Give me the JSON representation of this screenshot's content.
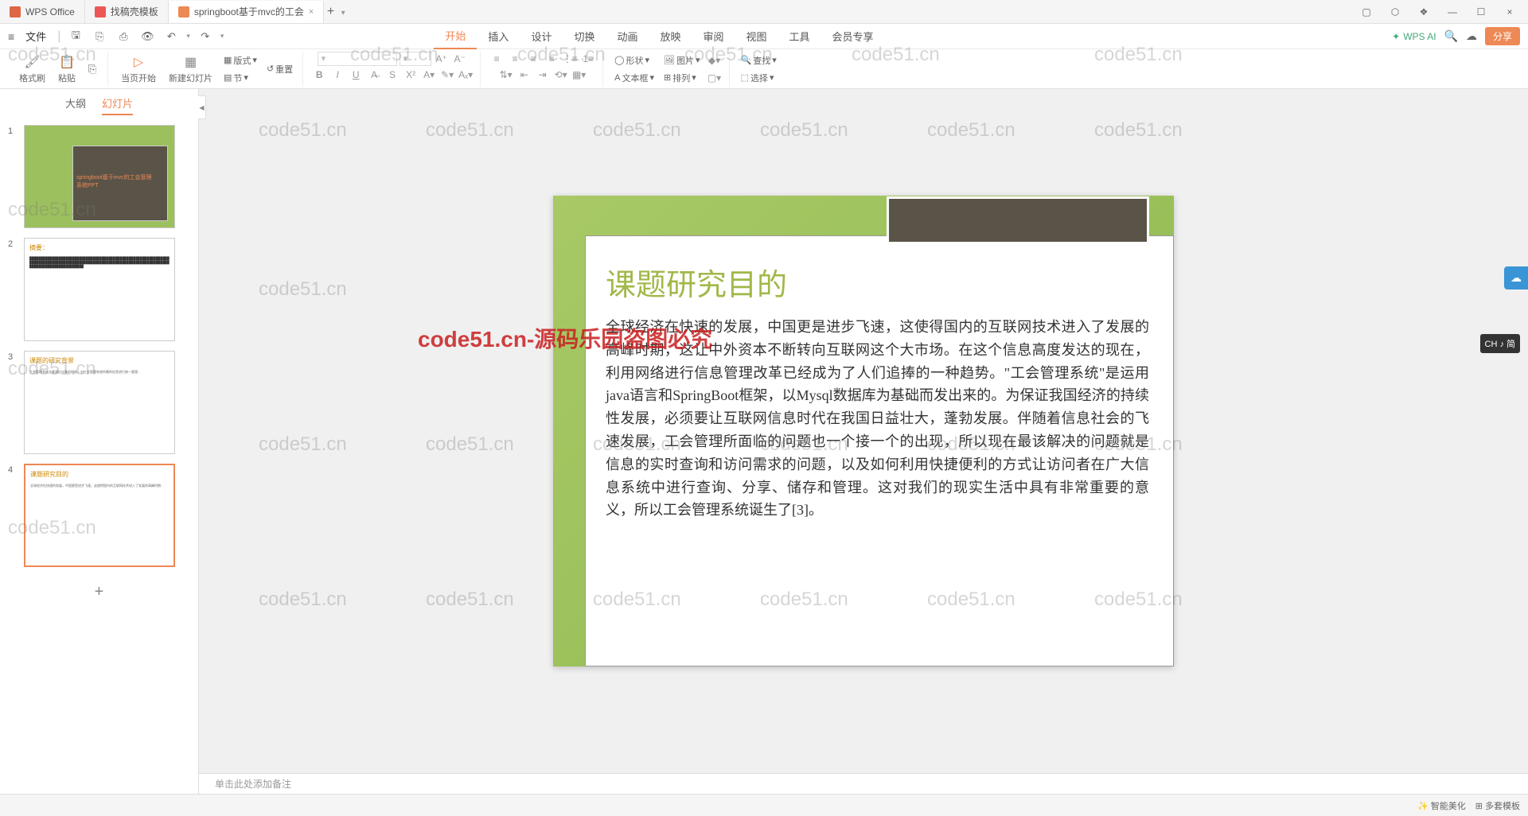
{
  "tabs": {
    "wps": "WPS Office",
    "docer": "找稿壳模板",
    "file": "springboot基于mvc的工会",
    "add": "+"
  },
  "menubar": {
    "file": "文件",
    "tabs": [
      "开始",
      "插入",
      "设计",
      "切换",
      "动画",
      "放映",
      "审阅",
      "视图",
      "工具",
      "会员专享"
    ],
    "wpsai": "WPS AI",
    "share": "分享"
  },
  "ribbon": {
    "format_painter": "格式刷",
    "paste": "粘贴",
    "from_current": "当页开始",
    "new_slide": "新建幻灯片",
    "layout": "版式",
    "section": "节",
    "reset": "重置",
    "shape": "形状",
    "picture": "图片",
    "textbox": "文本框",
    "arrange": "排列",
    "find": "查找",
    "select": "选择"
  },
  "sidebar": {
    "outline": "大纲",
    "slides": "幻灯片",
    "thumbs": [
      {
        "title": "springboot基于mvc的工会管理系统PPT"
      },
      {
        "title": "摘要："
      },
      {
        "title": "课题的研究背景"
      },
      {
        "title": "课题研究目的"
      }
    ]
  },
  "slide": {
    "title": "课题研究目的",
    "body": "全球经济在快速的发展，中国更是进步飞速，这使得国内的互联网技术进入了发展的高峰时期，这让中外资本不断转向互联网这个大市场。在这个信息高度发达的现在，利用网络进行信息管理改革已经成为了人们追捧的一种趋势。\"工会管理系统\"是运用java语言和SpringBoot框架，以Mysql数据库为基础而发出来的。为保证我国经济的持续性发展，必须要让互联网信息时代在我国日益壮大，蓬勃发展。伴随着信息社会的飞速发展，工会管理所面临的问题也一个接一个的出现，所以现在最该解决的问题就是信息的实时查询和访问需求的问题，以及如何利用快捷便利的方式让访问者在广大信息系统中进行查询、分享、储存和管理。这对我们的现实生活中具有非常重要的意义，所以工会管理系统诞生了[3]。"
  },
  "notes": "单击此处添加备注",
  "watermark": "code51.cn",
  "watermark_red": "code51.cn-源码乐园盗图必究",
  "float_lang": "CH ♪ 简",
  "status": {
    "beautify": "智能美化",
    "templates": "多套模板"
  }
}
